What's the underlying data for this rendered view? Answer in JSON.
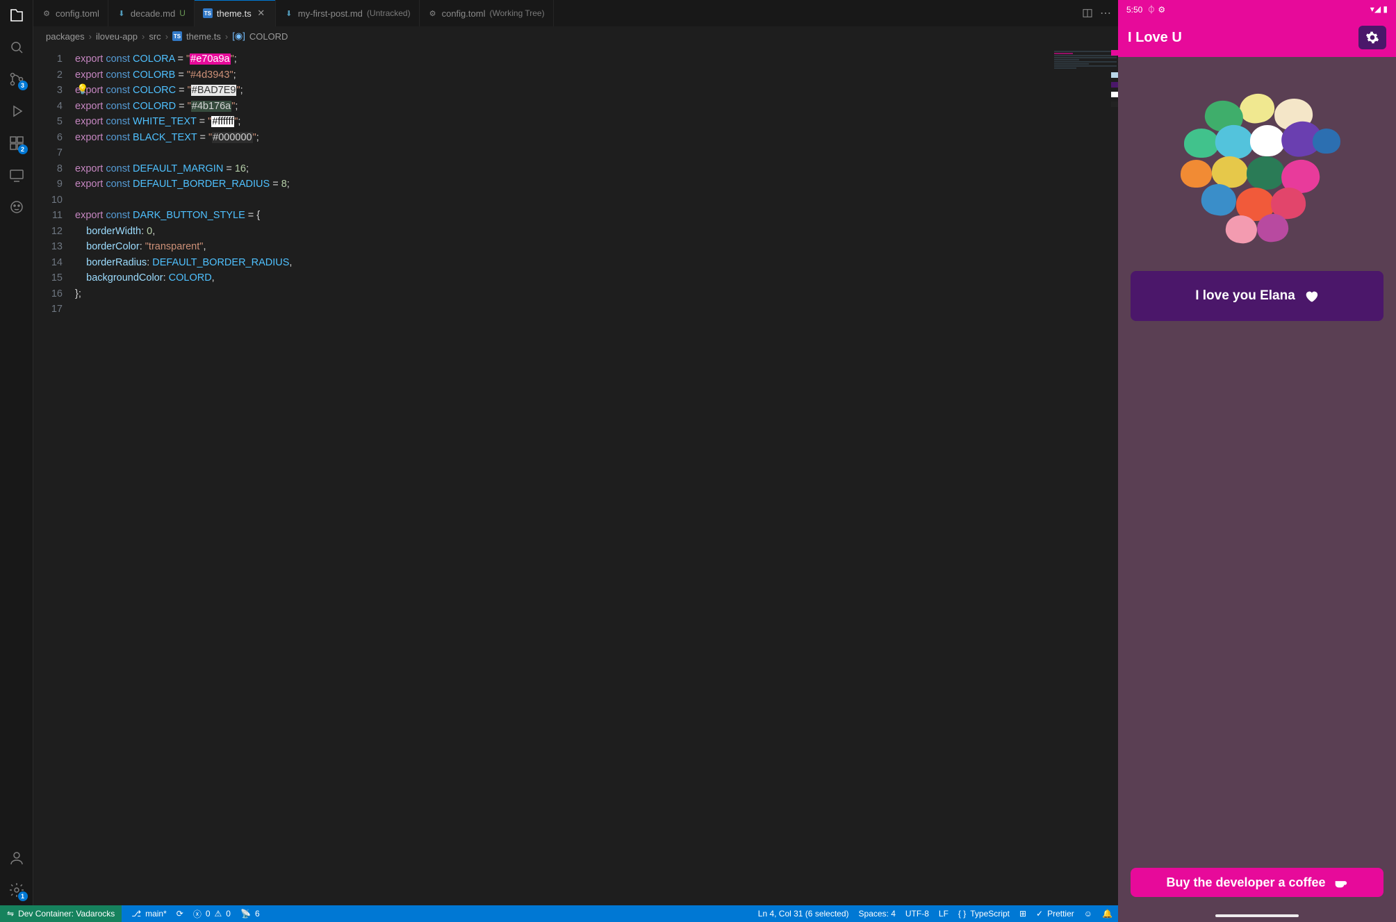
{
  "activityBadges": {
    "scm": "3",
    "ext": "2",
    "settings": "1"
  },
  "tabs": [
    {
      "icon": "gear",
      "label": "config.toml",
      "status": ""
    },
    {
      "icon": "md",
      "label": "decade.md",
      "status": "U"
    },
    {
      "icon": "ts",
      "label": "theme.ts",
      "status": "",
      "active": true,
      "close": true
    },
    {
      "icon": "md",
      "label": "my-first-post.md",
      "status": "(Untracked)"
    },
    {
      "icon": "gear",
      "label": "config.toml",
      "status": "(Working Tree)"
    }
  ],
  "breadcrumb": [
    "packages",
    "iloveu-app",
    "src",
    "theme.ts",
    "COLORD"
  ],
  "code": {
    "colora": "#e70a9a",
    "colorb": "#4d3943",
    "colorc": "#BAD7E9",
    "colord": "#4b176a",
    "white": "#ffffff",
    "black": "#000000",
    "margin": "16",
    "radius": "8",
    "bw": "0",
    "bc": "transparent"
  },
  "status": {
    "dev": "Dev Container: Vadarocks",
    "branch": "main*",
    "errors": "0",
    "warnings": "0",
    "ports": "6",
    "cursor": "Ln 4, Col 31 (6 selected)",
    "spaces": "Spaces: 4",
    "enc": "UTF-8",
    "eol": "LF",
    "lang": "TypeScript",
    "prettier": "Prettier"
  },
  "phone": {
    "time": "5:50",
    "appTitle": "I Love U",
    "mainButton": "I love you Elana",
    "coffee": "Buy the developer a coffee"
  }
}
